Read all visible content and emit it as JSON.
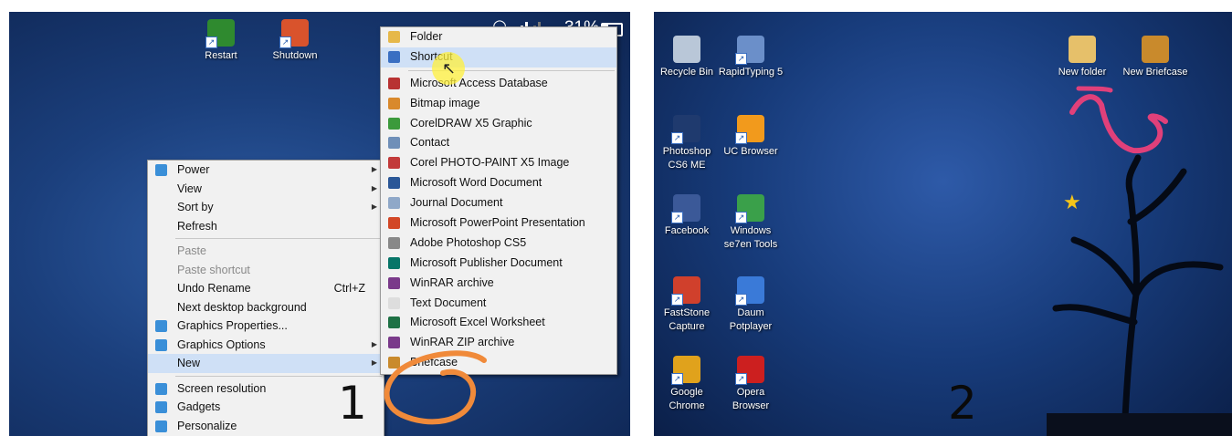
{
  "panel1": {
    "status": {
      "battery_text": "31%",
      "battery_level": 0.31
    },
    "desktop_icons": [
      {
        "label": "Restart",
        "icon": "tree-icon",
        "color": "#2f8a2f"
      },
      {
        "label": "Shutdown",
        "icon": "power-icon",
        "color": "#d9532c"
      }
    ],
    "context_menu": [
      {
        "label": "Power",
        "icon": "power-settings-icon",
        "submenu": true
      },
      {
        "label": "View",
        "submenu": true
      },
      {
        "label": "Sort by",
        "submenu": true
      },
      {
        "label": "Refresh"
      },
      {
        "label": "Paste",
        "disabled": true
      },
      {
        "label": "Paste shortcut",
        "disabled": true
      },
      {
        "label": "Undo Rename",
        "shortcut": "Ctrl+Z"
      },
      {
        "label": "Next desktop background"
      },
      {
        "label": "Graphics Properties...",
        "icon": "graphics-icon"
      },
      {
        "label": "Graphics Options",
        "icon": "graphics-icon",
        "submenu": true
      },
      {
        "label": "New",
        "submenu": true,
        "selected": true
      },
      {
        "label": "Screen resolution",
        "icon": "monitor-icon"
      },
      {
        "label": "Gadgets",
        "icon": "gadgets-icon"
      },
      {
        "label": "Personalize",
        "icon": "personalize-icon"
      }
    ],
    "new_submenu": [
      {
        "label": "Folder",
        "icon": "folder-icon",
        "color": "#e6b84a"
      },
      {
        "label": "Shortcut",
        "icon": "shortcut-icon",
        "color": "#3a6fc2",
        "highlighted": true
      },
      {
        "label": "Microsoft Access Database",
        "icon": "access-icon",
        "color": "#b83232"
      },
      {
        "label": "Bitmap image",
        "icon": "bitmap-icon",
        "color": "#d9892c"
      },
      {
        "label": "CorelDRAW X5 Graphic",
        "icon": "coreldraw-icon",
        "color": "#3c9a3c"
      },
      {
        "label": "Contact",
        "icon": "contact-icon",
        "color": "#6f8fb8"
      },
      {
        "label": "Corel PHOTO-PAINT X5 Image",
        "icon": "photopaint-icon",
        "color": "#c23a3a"
      },
      {
        "label": "Microsoft Word Document",
        "icon": "word-icon",
        "color": "#2b5797"
      },
      {
        "label": "Journal Document",
        "icon": "journal-icon",
        "color": "#8fa8c8"
      },
      {
        "label": "Microsoft PowerPoint Presentation",
        "icon": "powerpoint-icon",
        "color": "#d24726"
      },
      {
        "label": "Adobe Photoshop CS5",
        "icon": "photoshop-icon",
        "color": "#888888"
      },
      {
        "label": "Microsoft Publisher Document",
        "icon": "publisher-icon",
        "color": "#077568"
      },
      {
        "label": "WinRAR archive",
        "icon": "winrar-icon",
        "color": "#7a3a8a"
      },
      {
        "label": "Text Document",
        "icon": "text-icon",
        "color": "#dddddd"
      },
      {
        "label": "Microsoft Excel Worksheet",
        "icon": "excel-icon",
        "color": "#1e7145"
      },
      {
        "label": "WinRAR ZIP archive",
        "icon": "winrar-zip-icon",
        "color": "#7a3a8a"
      },
      {
        "label": "Briefcase",
        "icon": "briefcase-icon",
        "color": "#c98a2c"
      }
    ],
    "step_number": "1"
  },
  "panel2": {
    "desktop_icons": [
      {
        "label": "Recycle Bin",
        "icon": "recycle-bin-icon",
        "color": "#b9c7d8"
      },
      {
        "label": "RapidTyping 5",
        "icon": "rapidtyping-icon",
        "color": "#6b8fc9"
      },
      {
        "label": "Photoshop CS6 ME",
        "icon": "photoshop-icon",
        "color": "#1f3a6e"
      },
      {
        "label": "UC Browser",
        "icon": "uc-browser-icon",
        "color": "#f29a1c"
      },
      {
        "label": "Facebook",
        "icon": "facebook-icon",
        "color": "#3b5998"
      },
      {
        "label": "Windows se7en Tools",
        "icon": "windows-tools-icon",
        "color": "#3aa04a"
      },
      {
        "label": "FastStone Capture",
        "icon": "faststone-icon",
        "color": "#d0402c"
      },
      {
        "label": "Daum Potplayer",
        "icon": "potplayer-icon",
        "color": "#3a7ad8"
      },
      {
        "label": "Google Chrome",
        "icon": "chrome-icon",
        "color": "#e0a21c"
      },
      {
        "label": "Opera Browser",
        "icon": "opera-icon",
        "color": "#cc1f1f"
      },
      {
        "label": "New folder",
        "icon": "folder-icon",
        "color": "#e6c06a"
      },
      {
        "label": "New Briefcase",
        "icon": "briefcase-icon",
        "color": "#c98a2c"
      }
    ],
    "step_number": "2"
  }
}
